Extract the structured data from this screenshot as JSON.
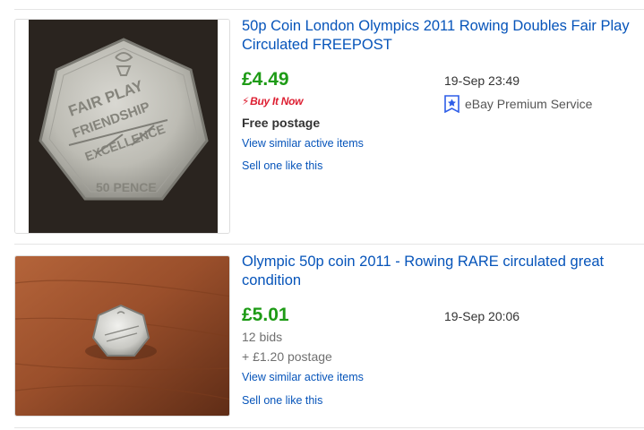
{
  "listings": [
    {
      "title": "50p Coin London Olympics 2011 Rowing Doubles Fair Play Circulated FREEPOST",
      "price": "£4.49",
      "date": "19-Sep 23:49",
      "buy_it_now": "Buy It Now",
      "premium_service": "eBay Premium Service",
      "postage": "Free postage",
      "view_similar": "View similar active items",
      "sell_one": "Sell one like this",
      "coin_text": {
        "denomination": "50 PENCE",
        "arc_top": "EXCELLENCE FRIENDSHIP",
        "values": [
          "FAIR PLAY",
          "FRIENDSHIP",
          "EXCELLENCE"
        ]
      }
    },
    {
      "title": "Olympic 50p coin 2011 - Rowing RARE circulated great condition",
      "price": "£5.01",
      "date": "19-Sep 20:06",
      "bids": "12 bids",
      "postage": "+ £1.20 postage",
      "view_similar": "View similar active items",
      "sell_one": "Sell one like this"
    }
  ],
  "colors": {
    "link": "#0654ba",
    "price": "#1e9b16",
    "buy_it_now": "#dd1e31",
    "premium_badge": "#2e5ee8"
  },
  "icons": [
    "buy-it-now-bolt-icon",
    "premium-service-ribbon-icon"
  ]
}
